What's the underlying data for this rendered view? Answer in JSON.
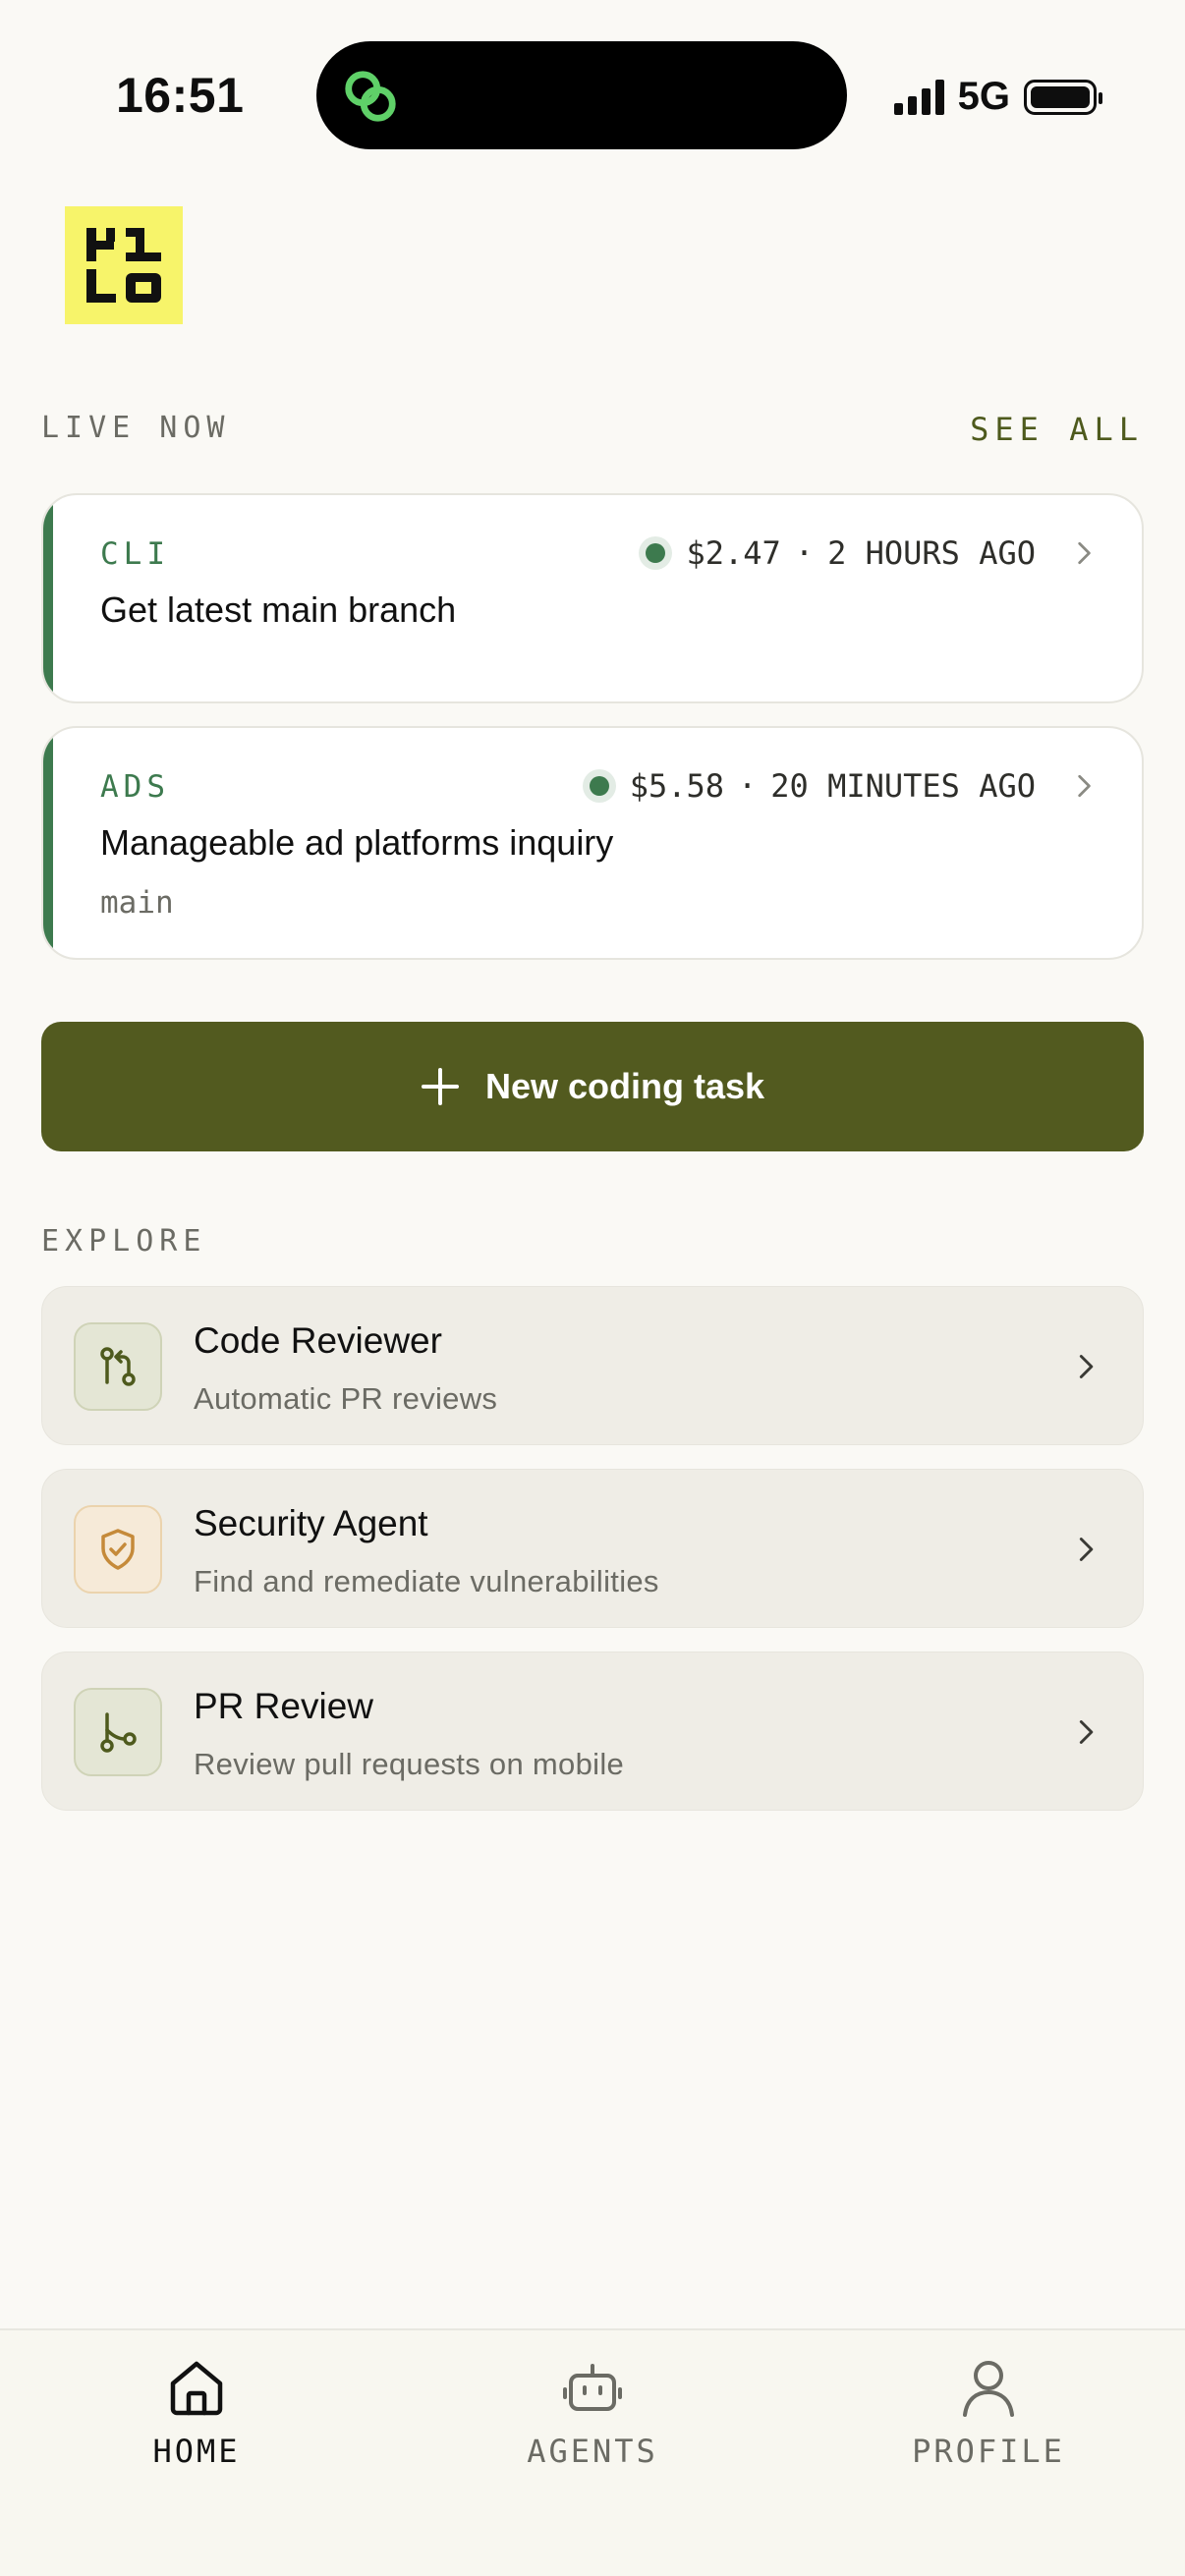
{
  "status_bar": {
    "time": "16:51",
    "network": "5G",
    "icons": [
      "link-icon",
      "signal-icon",
      "battery-icon"
    ]
  },
  "logo": {
    "icon": "kilo-logo"
  },
  "live_now": {
    "label": "LIVE NOW",
    "see_all": "SEE ALL",
    "cards": [
      {
        "tag": "CLI",
        "cost": "$2.47",
        "separator": "·",
        "time_ago": "2 HOURS AGO",
        "title": "Get latest main branch",
        "branch": ""
      },
      {
        "tag": "ADS",
        "cost": "$5.58",
        "separator": "·",
        "time_ago": "20 MINUTES AGO",
        "title": "Manageable ad platforms inquiry",
        "branch": "main"
      }
    ]
  },
  "new_task": {
    "label": "New coding task",
    "icon": "plus-icon"
  },
  "explore": {
    "label": "EXPLORE",
    "items": [
      {
        "name": "Code Reviewer",
        "description": "Automatic PR reviews",
        "icon": "git-compare-icon"
      },
      {
        "name": "Security Agent",
        "description": "Find and remediate vulnerabilities",
        "icon": "shield-check-icon"
      },
      {
        "name": "PR Review",
        "description": "Review pull requests on mobile",
        "icon": "git-branch-icon"
      }
    ]
  },
  "bottom_nav": {
    "items": [
      {
        "label": "HOME",
        "icon": "home-icon",
        "active": true
      },
      {
        "label": "AGENTS",
        "icon": "robot-icon",
        "active": false
      },
      {
        "label": "PROFILE",
        "icon": "user-icon",
        "active": false
      }
    ]
  },
  "colors": {
    "background": "#faf9f5",
    "accent_olive": "#525a1f",
    "live_green": "#3d7a4e",
    "logo_yellow": "#f7f46a",
    "security_orange": "#c58a3a"
  }
}
